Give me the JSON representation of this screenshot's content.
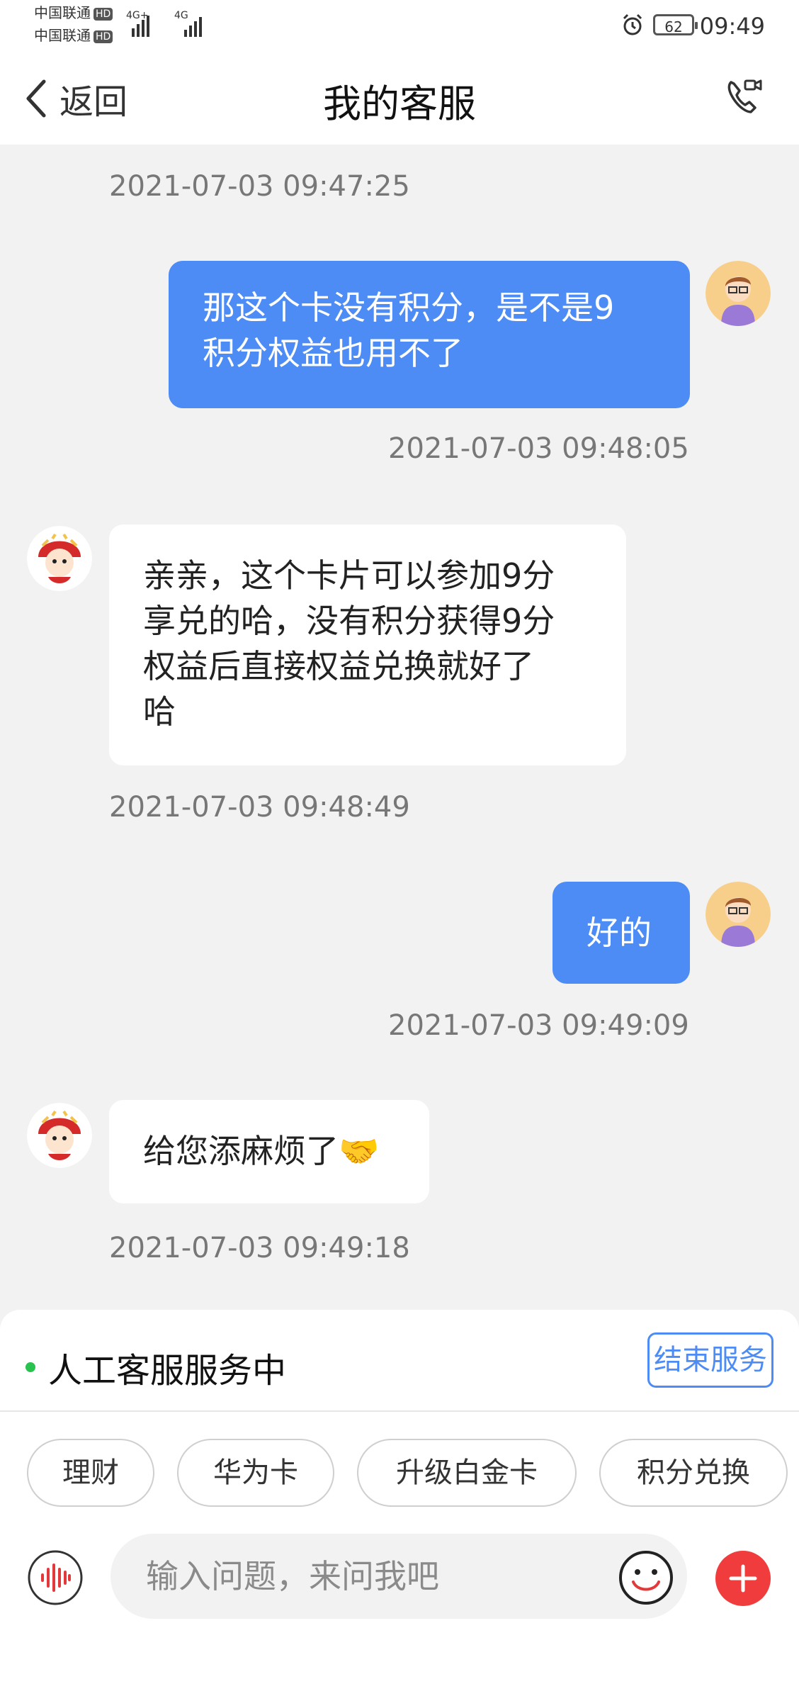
{
  "status_bar": {
    "carrier_1": "中国联通",
    "carrier_2": "中国联通",
    "hd_badge": "HD",
    "net_1": "4G+",
    "net_2": "4G",
    "battery": "62",
    "time": "09:49"
  },
  "nav": {
    "back_label": "返回",
    "title": "我的客服"
  },
  "messages": [
    {
      "timestamp": "2021-07-03 09:47:25"
    },
    {
      "sender": "me",
      "text_lines": [
        "那这个卡没有积分，是不是9",
        "积分权益也用不了"
      ],
      "timestamp": "2021-07-03 09:48:05"
    },
    {
      "sender": "agent",
      "text_lines": [
        "亲亲，这个卡片可以参加9分",
        "享兑的哈，没有积分获得9分",
        "权益后直接权益兑换就好了",
        "哈"
      ],
      "timestamp": "2021-07-03 09:48:49"
    },
    {
      "sender": "me",
      "text_lines": [
        "好的"
      ],
      "timestamp": "2021-07-03 09:49:09"
    },
    {
      "sender": "agent",
      "text_lines": [
        "给您添麻烦了🤝"
      ],
      "timestamp": "2021-07-03 09:49:18"
    }
  ],
  "service": {
    "status_text": "人工客服服务中",
    "end_button": "结束服务"
  },
  "quick_replies": [
    "理财",
    "华为卡",
    "升级白金卡",
    "积分兑换"
  ],
  "composer": {
    "placeholder": "输入问题，来问我吧"
  },
  "colors": {
    "accent": "#4d8cf5",
    "online": "#29c24f",
    "plus": "#f03c3c",
    "background": "#f2f2f2"
  },
  "icons": [
    "back-chevron-icon",
    "phone-video-icon",
    "voice-icon",
    "emoji-icon",
    "plus-icon",
    "alarm-icon"
  ]
}
